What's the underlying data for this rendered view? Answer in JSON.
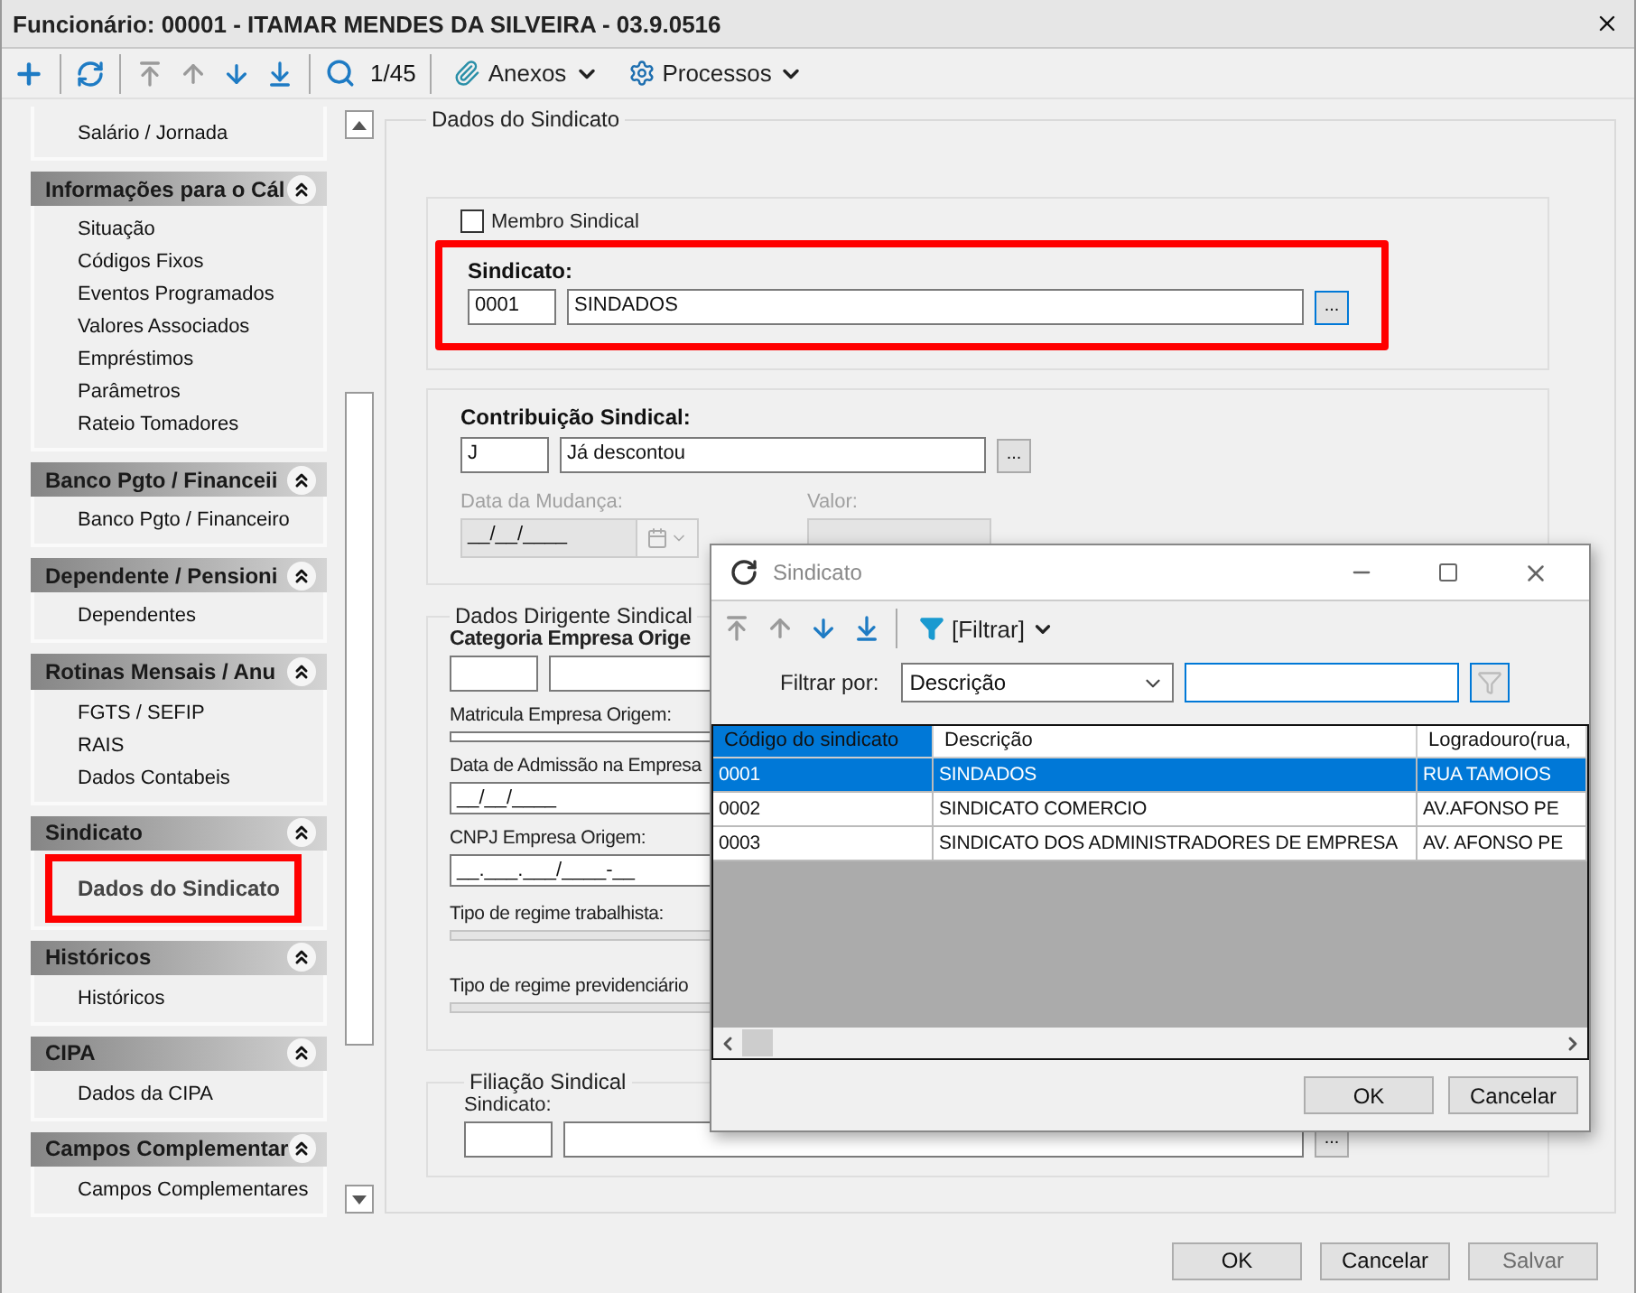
{
  "window": {
    "title": "Funcionário: 00001 - ITAMAR MENDES DA SILVEIRA - 03.9.0516"
  },
  "toolbar": {
    "nav": [
      {
        "kind": "first",
        "disabled": true
      },
      {
        "kind": "up",
        "disabled": true
      },
      {
        "kind": "down",
        "disabled": false
      },
      {
        "kind": "last",
        "disabled": false
      }
    ],
    "record": "1/45",
    "menus": [
      {
        "kind": "attachments",
        "label": "Anexos"
      },
      {
        "kind": "processes",
        "label": "Processos"
      }
    ]
  },
  "sidebar": {
    "top_items": [
      {
        "label": "Salário / Jornada",
        "selected": false,
        "annotated": false
      }
    ],
    "groups": [
      {
        "title": "Informações para o Cál",
        "items": [
          {
            "label": "Situação",
            "selected": false,
            "annotated": false
          },
          {
            "label": "Códigos Fixos",
            "selected": false,
            "annotated": false
          },
          {
            "label": "Eventos Programados",
            "selected": false,
            "annotated": false
          },
          {
            "label": "Valores Associados",
            "selected": false,
            "annotated": false
          },
          {
            "label": "Empréstimos",
            "selected": false,
            "annotated": false
          },
          {
            "label": "Parâmetros",
            "selected": false,
            "annotated": false
          },
          {
            "label": "Rateio Tomadores",
            "selected": false,
            "annotated": false
          }
        ]
      },
      {
        "title": "Banco Pgto / Financeii",
        "items": [
          {
            "label": "Banco Pgto / Financeiro",
            "selected": false,
            "annotated": false
          }
        ]
      },
      {
        "title": "Dependente / Pensioni",
        "items": [
          {
            "label": "Dependentes",
            "selected": false,
            "annotated": false
          }
        ]
      },
      {
        "title": "Rotinas Mensais / Anu",
        "items": [
          {
            "label": "FGTS / SEFIP",
            "selected": false,
            "annotated": false
          },
          {
            "label": "RAIS",
            "selected": false,
            "annotated": false
          },
          {
            "label": "Dados Contabeis",
            "selected": false,
            "annotated": false
          }
        ]
      },
      {
        "title": "Sindicato",
        "items": [
          {
            "label": "Dados do Sindicato",
            "selected": true,
            "annotated": true
          }
        ]
      },
      {
        "title": "Históricos",
        "items": [
          {
            "label": "Históricos",
            "selected": false,
            "annotated": false
          }
        ]
      },
      {
        "title": "CIPA",
        "items": [
          {
            "label": "Dados da CIPA",
            "selected": false,
            "annotated": false
          }
        ]
      },
      {
        "title": "Campos Complementar",
        "items": [
          {
            "label": "Campos Complementares",
            "selected": false,
            "annotated": false
          }
        ]
      }
    ]
  },
  "form": {
    "legend": "Dados do Sindicato",
    "membro": {
      "label": "Membro Sindical",
      "checked": false
    },
    "sindicato": {
      "label": "Sindicato:",
      "code": "0001",
      "name": "SINDADOS",
      "button": "...",
      "focused": true,
      "annotated": true
    },
    "contribuicao": {
      "label": "Contribuição Sindical:",
      "code": "J",
      "name": "Já descontou",
      "button": "...",
      "date_label": "Data da Mudança:",
      "date_value": "__/__/____",
      "value_label": "Valor:",
      "disabled": true
    },
    "dirigente": {
      "legend": "Dados Dirigente Sindical",
      "fields": [
        {
          "kind": "pair",
          "label": "Categoria Empresa Orige"
        },
        {
          "kind": "text",
          "label": "Matricula Empresa Origem:"
        },
        {
          "kind": "text",
          "label": "Data de Admissão na Empresa",
          "value": "__/__/____"
        },
        {
          "kind": "text",
          "label": "CNPJ Empresa Origem:",
          "value": "__.___.___/____-__"
        },
        {
          "kind": "readonly",
          "label": "Tipo de regime trabalhista:"
        },
        {
          "kind": "readonly",
          "label": "Tipo de regime previdenciário"
        }
      ]
    },
    "filiacao": {
      "legend": "Filiação Sindical",
      "label": "Sindicato:",
      "button": "..."
    }
  },
  "buttons": [
    {
      "label": "OK",
      "disabled": false
    },
    {
      "label": "Cancelar",
      "disabled": false
    },
    {
      "label": "Salvar",
      "disabled": true
    }
  ],
  "dialog": {
    "title": "Sindicato",
    "nav": [
      {
        "kind": "first",
        "disabled": true
      },
      {
        "kind": "up",
        "disabled": true
      },
      {
        "kind": "down",
        "disabled": false
      },
      {
        "kind": "last",
        "disabled": false
      }
    ],
    "filter_menu": "[Filtrar]",
    "filter_label": "Filtrar por:",
    "filter_select": "Descrição",
    "columns": [
      {
        "label": "Código do sindicato",
        "selected": true
      },
      {
        "label": "Descrição",
        "selected": false
      },
      {
        "label": "Logradouro(rua,",
        "selected": false
      }
    ],
    "rows": [
      {
        "cells": [
          "0001",
          "SINDADOS",
          "RUA TAMOIOS"
        ],
        "selected": true
      },
      {
        "cells": [
          "0002",
          "SINDICATO COMERCIO",
          "AV.AFONSO PE"
        ],
        "selected": false
      },
      {
        "cells": [
          "0003",
          "SINDICATO DOS ADMINISTRADORES DE EMPRESA",
          "AV. AFONSO PE"
        ],
        "selected": false
      }
    ],
    "buttons": [
      "OK",
      "Cancelar"
    ]
  }
}
